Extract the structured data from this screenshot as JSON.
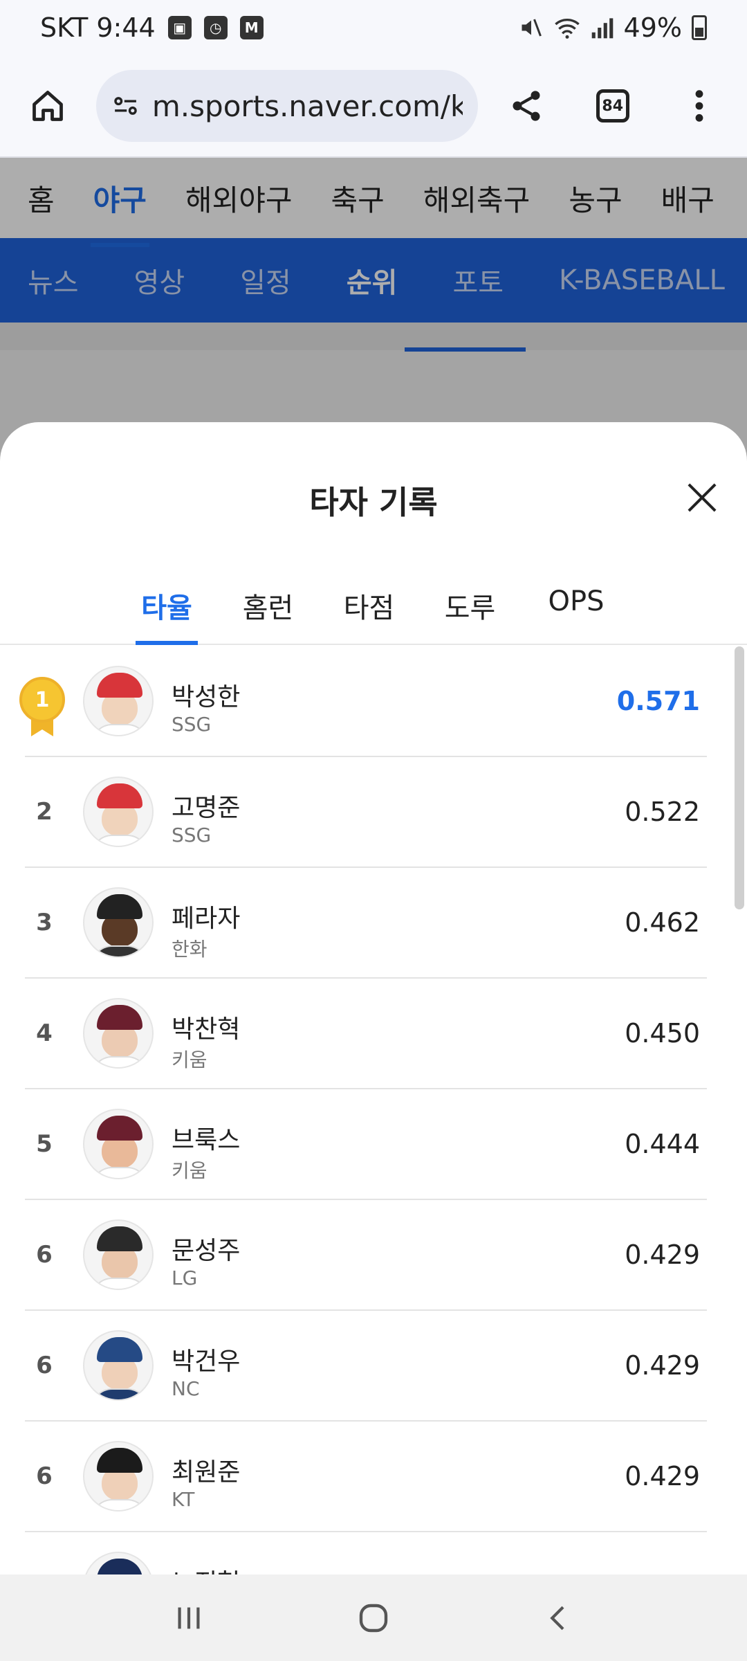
{
  "status_bar": {
    "carrier_time": "SKT 9:44",
    "stock_icon_label": "M",
    "battery": "49%"
  },
  "browser": {
    "url": "m.sports.naver.com/kb",
    "tab_count": "84"
  },
  "sport_nav": [
    "홈",
    "야구",
    "해외야구",
    "축구",
    "해외축구",
    "농구",
    "배구"
  ],
  "sub_nav": [
    "뉴스",
    "영상",
    "일정",
    "순위",
    "포토",
    "K-BASEBALL"
  ],
  "sheet": {
    "title": "타자 기록",
    "tabs": [
      "타율",
      "홈런",
      "타점",
      "도루",
      "OPS"
    ],
    "active_tab": 0
  },
  "players": [
    {
      "rank": "1",
      "name": "박성한",
      "team": "SSG",
      "value": "0.571",
      "cap": "#d8353a",
      "face": "#f0d3bb",
      "shirt": "#ffffff"
    },
    {
      "rank": "2",
      "name": "고명준",
      "team": "SSG",
      "value": "0.522",
      "cap": "#d8353a",
      "face": "#f0d3bb",
      "shirt": "#ffffff"
    },
    {
      "rank": "3",
      "name": "페라자",
      "team": "한화",
      "value": "0.462",
      "cap": "#222222",
      "face": "#5a3a26",
      "shirt": "#333333"
    },
    {
      "rank": "4",
      "name": "박찬혁",
      "team": "키움",
      "value": "0.450",
      "cap": "#6b1f2e",
      "face": "#eccbb3",
      "shirt": "#ffffff"
    },
    {
      "rank": "5",
      "name": "브룩스",
      "team": "키움",
      "value": "0.444",
      "cap": "#6b1f2e",
      "face": "#e9b999",
      "shirt": "#ffffff"
    },
    {
      "rank": "6",
      "name": "문성주",
      "team": "LG",
      "value": "0.429",
      "cap": "#2a2a2a",
      "face": "#eac6ab",
      "shirt": "#ffffff"
    },
    {
      "rank": "6",
      "name": "박건우",
      "team": "NC",
      "value": "0.429",
      "cap": "#254a85",
      "face": "#efd0b8",
      "shirt": "#1f3c6e"
    },
    {
      "rank": "6",
      "name": "최원준",
      "team": "KT",
      "value": "0.429",
      "cap": "#1b1b1b",
      "face": "#efd0b8",
      "shirt": "#ffffff"
    },
    {
      "rank": "",
      "name": "노진혁",
      "team": "",
      "value": "",
      "cap": "#1a2d5a",
      "face": "#efd0b8",
      "shirt": "#ffffff"
    }
  ],
  "colors": {
    "accent": "#1f6ee9",
    "subnav_bg": "#1f63dc",
    "medal": "#f6c531"
  }
}
